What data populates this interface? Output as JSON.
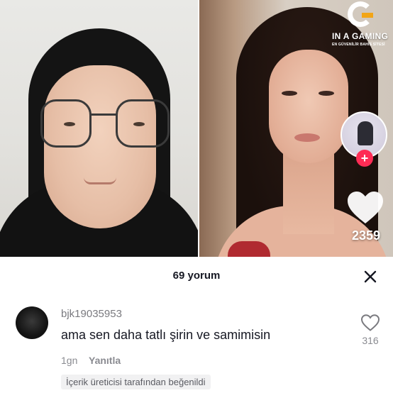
{
  "watermark": {
    "title": "IN A GAMING",
    "subtitle": "EN GÜVENİLİR BAHİS SİTESİ"
  },
  "video": {
    "like_count": "2359",
    "follow_symbol": "+"
  },
  "comments": {
    "header": "69 yorum",
    "items": [
      {
        "username": "bjk19035953",
        "text": "ama sen daha tatlı şirin ve samimisin",
        "time": "1gn",
        "reply_label": "Yanıtla",
        "badge": "İçerik üreticisi tarafından beğenildi",
        "like_count": "316"
      }
    ]
  },
  "colors": {
    "accent": "#fe2c55",
    "logo_accent": "#f2a516",
    "text_primary": "#161823",
    "text_secondary": "#8a8b91"
  },
  "icons": [
    "close-icon",
    "heart-icon",
    "plus-icon"
  ]
}
